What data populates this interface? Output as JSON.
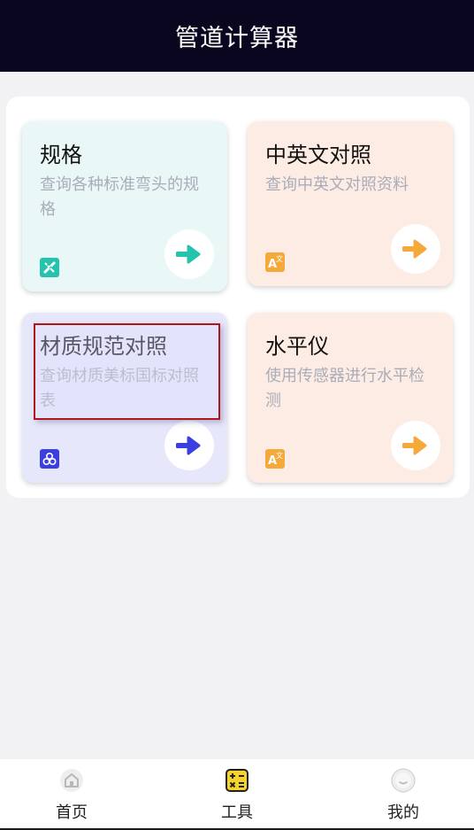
{
  "header": {
    "title": "管道计算器"
  },
  "cards": [
    {
      "title": "规格",
      "desc": "查询各种标准弯头的规格",
      "icon": "ruler-pencil-icon",
      "accent": "#23c3ae"
    },
    {
      "title": "中英文对照",
      "desc": "查询中英文对照资料",
      "icon": "translate-icon",
      "accent": "#f6a93b"
    },
    {
      "title": "材质规范对照",
      "desc": "查询材质美标国标对照表",
      "icon": "cubes-icon",
      "accent": "#3b3fe0"
    },
    {
      "title": "水平仪",
      "desc": "使用传感器进行水平检测",
      "icon": "translate-icon",
      "accent": "#f6a93b"
    }
  ],
  "tabbar": {
    "items": [
      {
        "label": "首页",
        "icon": "home-icon",
        "active": false
      },
      {
        "label": "工具",
        "icon": "calculator-icon",
        "active": true
      },
      {
        "label": "我的",
        "icon": "smile-icon",
        "active": false
      }
    ]
  },
  "colors": {
    "header_bg": "#0b0620",
    "teal": "#23c3ae",
    "orange": "#f6a93b",
    "indigo": "#3b3fe0",
    "highlight_border": "#b01818"
  }
}
